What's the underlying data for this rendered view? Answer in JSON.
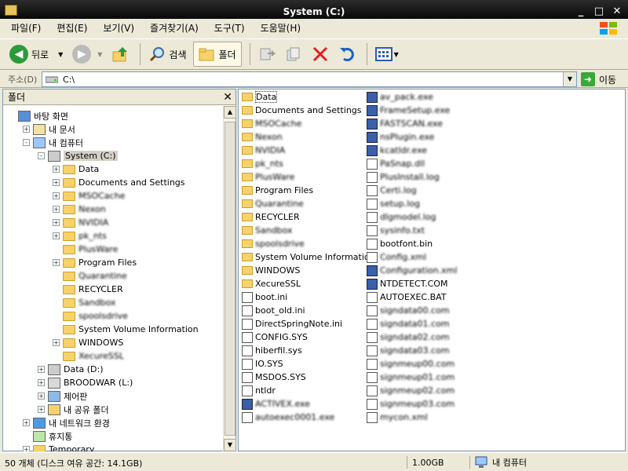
{
  "window": {
    "title": "System (C:)"
  },
  "menu": [
    "파일(F)",
    "편집(E)",
    "보기(V)",
    "즐겨찾기(A)",
    "도구(T)",
    "도움말(H)"
  ],
  "toolbar": {
    "back": "뒤로",
    "search": "검색",
    "folders": "폴더"
  },
  "address": {
    "label": "주소(D)",
    "value": "C:\\",
    "go": "이동"
  },
  "left_pane": {
    "title": "폴더",
    "tree": [
      {
        "label": "바탕 화면",
        "level": 0,
        "expander": "",
        "icon": "desktop-icon"
      },
      {
        "label": "내 문서",
        "level": 1,
        "expander": "+",
        "icon": "my-documents-icon"
      },
      {
        "label": "내 컴퓨터",
        "level": 1,
        "expander": "-",
        "icon": "my-computer-icon"
      },
      {
        "label": "System (C:)",
        "level": 2,
        "expander": "-",
        "icon": "drive-icon",
        "selected": true
      },
      {
        "label": "Data",
        "level": 3,
        "expander": "+",
        "icon": "folder-icon"
      },
      {
        "label": "Documents and Settings",
        "level": 3,
        "expander": "+",
        "icon": "folder-icon"
      },
      {
        "label": "MSOCache",
        "level": 3,
        "expander": "+",
        "icon": "folder-icon",
        "blurred": true
      },
      {
        "label": "Nexon",
        "level": 3,
        "expander": "+",
        "icon": "folder-icon",
        "blurred": true
      },
      {
        "label": "NVIDIA",
        "level": 3,
        "expander": "+",
        "icon": "folder-icon",
        "blurred": true
      },
      {
        "label": "pk_nts",
        "level": 3,
        "expander": "+",
        "icon": "folder-icon",
        "blurred": true
      },
      {
        "label": "PlusWare",
        "level": 3,
        "expander": "",
        "icon": "folder-icon",
        "blurred": true
      },
      {
        "label": "Program Files",
        "level": 3,
        "expander": "+",
        "icon": "folder-icon"
      },
      {
        "label": "Quarantine",
        "level": 3,
        "expander": "",
        "icon": "folder-icon",
        "blurred": true
      },
      {
        "label": "RECYCLER",
        "level": 3,
        "expander": "",
        "icon": "folder-icon"
      },
      {
        "label": "Sandbox",
        "level": 3,
        "expander": "",
        "icon": "folder-icon",
        "blurred": true
      },
      {
        "label": "spoolsdrive",
        "level": 3,
        "expander": "",
        "icon": "folder-icon",
        "blurred": true
      },
      {
        "label": "System Volume Information",
        "level": 3,
        "expander": "",
        "icon": "folder-icon"
      },
      {
        "label": "WINDOWS",
        "level": 3,
        "expander": "+",
        "icon": "folder-icon"
      },
      {
        "label": "XecureSSL",
        "level": 3,
        "expander": "",
        "icon": "folder-icon",
        "blurred": true
      },
      {
        "label": "Data (D:)",
        "level": 2,
        "expander": "+",
        "icon": "drive-icon"
      },
      {
        "label": "BROODWAR (L:)",
        "level": 2,
        "expander": "+",
        "icon": "cd-drive-icon"
      },
      {
        "label": "제어판",
        "level": 2,
        "expander": "+",
        "icon": "control-panel-icon"
      },
      {
        "label": "내 공유 폴더",
        "level": 2,
        "expander": "+",
        "icon": "shared-folder-icon"
      },
      {
        "label": "내 네트워크 환경",
        "level": 1,
        "expander": "+",
        "icon": "network-icon"
      },
      {
        "label": "휴지통",
        "level": 1,
        "expander": "",
        "icon": "recycle-bin-icon"
      },
      {
        "label": "Temporary",
        "level": 1,
        "expander": "+",
        "icon": "folder-icon"
      }
    ]
  },
  "files_col1": [
    {
      "name": "Data",
      "type": "folder"
    },
    {
      "name": "Documents and Settings",
      "type": "folder"
    },
    {
      "name": "MSOCache",
      "type": "folder",
      "blurred": true
    },
    {
      "name": "Nexon",
      "type": "folder",
      "blurred": true
    },
    {
      "name": "NVIDIA",
      "type": "folder",
      "blurred": true
    },
    {
      "name": "pk_nts",
      "type": "folder",
      "blurred": true
    },
    {
      "name": "PlusWare",
      "type": "folder",
      "blurred": true
    },
    {
      "name": "Program Files",
      "type": "folder"
    },
    {
      "name": "Quarantine",
      "type": "folder",
      "blurred": true
    },
    {
      "name": "RECYCLER",
      "type": "folder"
    },
    {
      "name": "Sandbox",
      "type": "folder",
      "blurred": true
    },
    {
      "name": "spoolsdrive",
      "type": "folder",
      "blurred": true
    },
    {
      "name": "System Volume Information",
      "type": "folder"
    },
    {
      "name": "WINDOWS",
      "type": "folder"
    },
    {
      "name": "XecureSSL",
      "type": "folder"
    },
    {
      "name": "boot.ini",
      "type": "file"
    },
    {
      "name": "boot_old.ini",
      "type": "file"
    },
    {
      "name": "DirectSpringNote.ini",
      "type": "file"
    },
    {
      "name": "CONFIG.SYS",
      "type": "file"
    },
    {
      "name": "hiberfil.sys",
      "type": "file"
    },
    {
      "name": "IO.SYS",
      "type": "file"
    },
    {
      "name": "MSDOS.SYS",
      "type": "file"
    },
    {
      "name": "ntldr",
      "type": "file"
    },
    {
      "name": "ACTIVEX.exe",
      "type": "exe",
      "blurred": true
    },
    {
      "name": "autoexec0001.exe",
      "type": "file",
      "blurred": true
    }
  ],
  "files_col2": [
    {
      "name": "av_pack.exe",
      "type": "exe",
      "blurred": true
    },
    {
      "name": "FrameSetup.exe",
      "type": "exe",
      "blurred": true
    },
    {
      "name": "FASTSCAN.exe",
      "type": "exe",
      "blurred": true
    },
    {
      "name": "nsPlugin.exe",
      "type": "exe",
      "blurred": true
    },
    {
      "name": "kcatldr.exe",
      "type": "exe",
      "blurred": true
    },
    {
      "name": "PaSnap.dll",
      "type": "file",
      "blurred": true
    },
    {
      "name": "PlusInstall.log",
      "type": "file",
      "blurred": true
    },
    {
      "name": "Certi.log",
      "type": "file",
      "blurred": true
    },
    {
      "name": "setup.log",
      "type": "file",
      "blurred": true
    },
    {
      "name": "dlgmodel.log",
      "type": "file",
      "blurred": true
    },
    {
      "name": "sysinfo.txt",
      "type": "file",
      "blurred": true
    },
    {
      "name": "bootfont.bin",
      "type": "file"
    },
    {
      "name": "Config.xml",
      "type": "file",
      "blurred": true
    },
    {
      "name": "Configuration.xml",
      "type": "exe",
      "blurred": true
    },
    {
      "name": "NTDETECT.COM",
      "type": "exe"
    },
    {
      "name": "AUTOEXEC.BAT",
      "type": "file"
    },
    {
      "name": "signdata00.com",
      "type": "file",
      "blurred": true
    },
    {
      "name": "signdata01.com",
      "type": "file",
      "blurred": true
    },
    {
      "name": "signdata02.com",
      "type": "file",
      "blurred": true
    },
    {
      "name": "signdata03.com",
      "type": "file",
      "blurred": true
    },
    {
      "name": "signmeup00.com",
      "type": "file",
      "blurred": true
    },
    {
      "name": "signmeup01.com",
      "type": "file",
      "blurred": true
    },
    {
      "name": "signmeup02.com",
      "type": "file",
      "blurred": true
    },
    {
      "name": "signmeup03.com",
      "type": "file",
      "blurred": true
    },
    {
      "name": "mycon.xml",
      "type": "file",
      "blurred": true
    }
  ],
  "status": {
    "count": "50 개체 (디스크 여유 공간: 14.1GB)",
    "size": "1.00GB",
    "location": "내 컴퓨터"
  }
}
